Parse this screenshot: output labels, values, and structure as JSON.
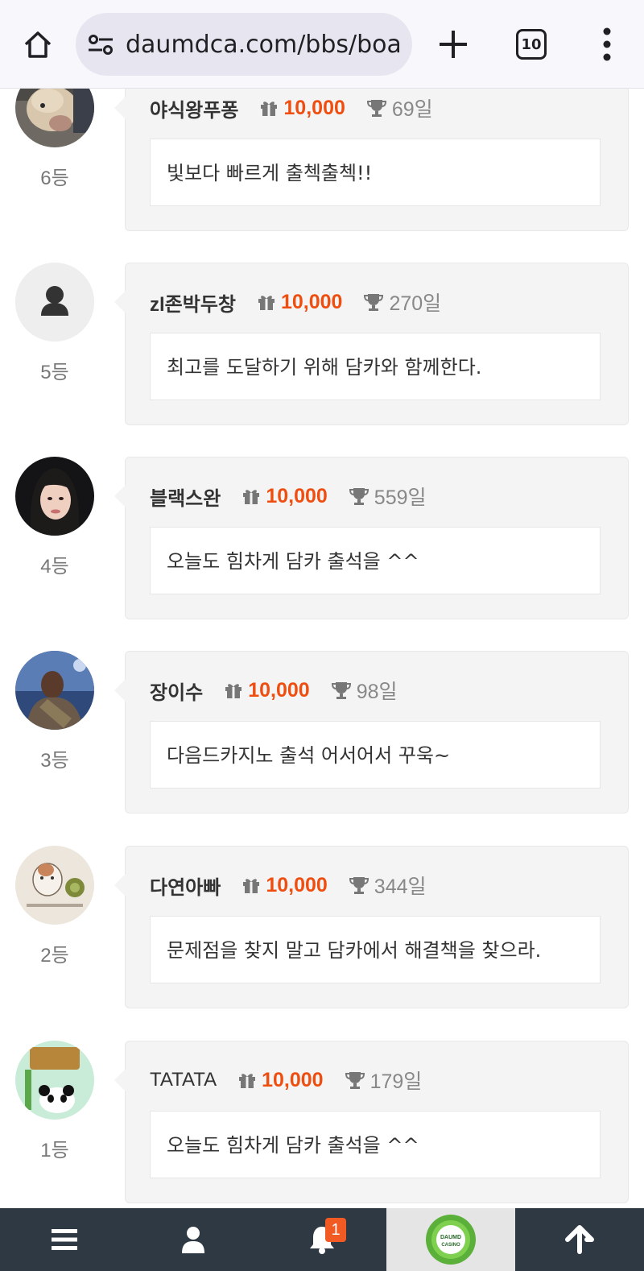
{
  "browser": {
    "url": "daumdca.com/bbs/board",
    "tab_count": "10"
  },
  "entries": [
    {
      "nick": "야식왕푸퐁",
      "points": "10,000",
      "days": "69일",
      "rank": "6등",
      "comment": "빛보다 빠르게 출첵출첵!!",
      "avatar": "dog-photo"
    },
    {
      "nick": "zl존박두창",
      "points": "10,000",
      "days": "270일",
      "rank": "5등",
      "comment": "최고를 도달하기 위해 담카와 함께한다.",
      "avatar": "default-user"
    },
    {
      "nick": "블랙스완",
      "points": "10,000",
      "days": "559일",
      "rank": "4등",
      "comment": "오늘도 힘차게 담카 출석을 ^^",
      "avatar": "woman-photo"
    },
    {
      "nick": "장이수",
      "points": "10,000",
      "days": "98일",
      "rank": "3등",
      "comment": "다음드카지노 출석 어서어서 꾸욱~",
      "avatar": "man-photo"
    },
    {
      "nick": "다연아빠",
      "points": "10,000",
      "days": "344일",
      "rank": "2등",
      "comment": "문제점을 찾지 말고 담카에서 해결책을 찾으라.",
      "avatar": "cat-drawing"
    },
    {
      "nick": "TATATA",
      "points": "10,000",
      "days": "179일",
      "rank": "1등",
      "comment": "오늘도 힘차게 담카 출석을 ^^",
      "avatar": "tatata-panda"
    }
  ],
  "bottom_nav": {
    "notification_count": "1",
    "logo_text_top": "DAUMD",
    "logo_text_bottom": "CASINO"
  },
  "colors": {
    "points": "#ee4e10",
    "nav_bg": "#2f3944",
    "badge": "#f15a22"
  }
}
